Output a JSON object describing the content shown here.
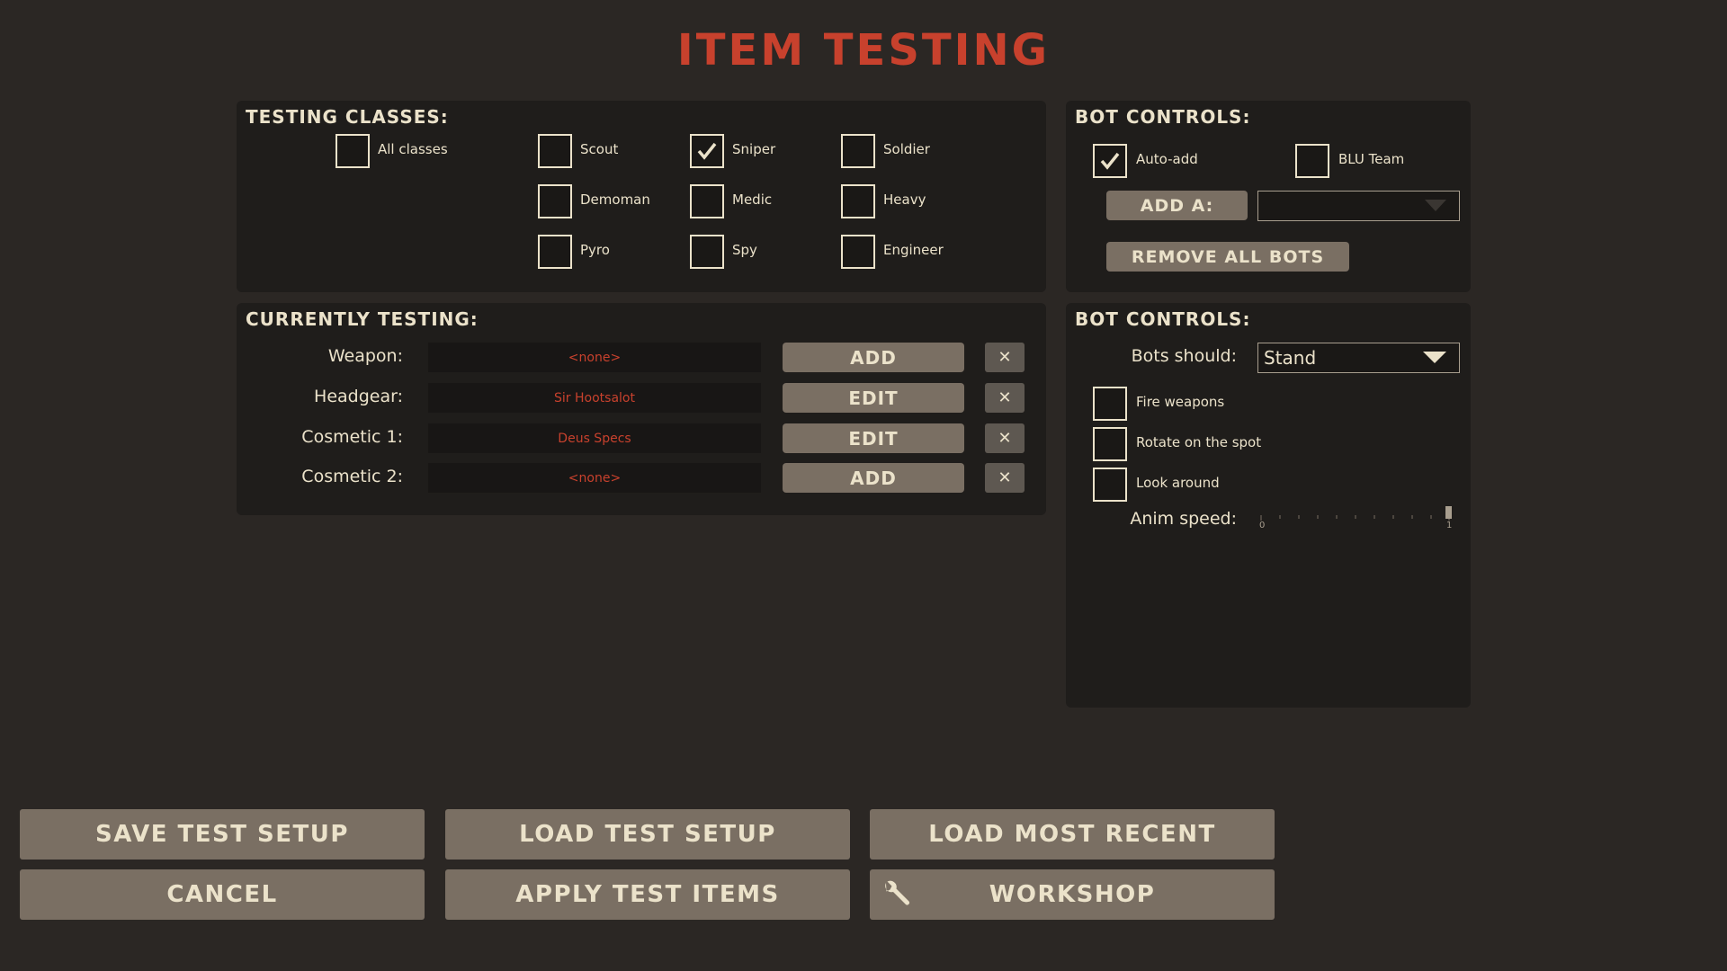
{
  "title": "ITEM TESTING",
  "classes_panel": {
    "heading": "TESTING CLASSES:",
    "items": [
      {
        "label": "All classes",
        "checked": false
      },
      {
        "label": "Scout",
        "checked": false
      },
      {
        "label": "Sniper",
        "checked": true
      },
      {
        "label": "Soldier",
        "checked": false
      },
      {
        "label": "Demoman",
        "checked": false
      },
      {
        "label": "Medic",
        "checked": false
      },
      {
        "label": "Heavy",
        "checked": false
      },
      {
        "label": "Pyro",
        "checked": false
      },
      {
        "label": "Spy",
        "checked": false
      },
      {
        "label": "Engineer",
        "checked": false
      }
    ]
  },
  "bot_controls_top": {
    "heading": "BOT CONTROLS:",
    "auto_add": {
      "label": "Auto-add",
      "checked": true
    },
    "blu_team": {
      "label": "BLU Team",
      "checked": false
    },
    "add_a_label": "ADD A:",
    "add_a_value": "",
    "remove_all_label": "REMOVE ALL BOTS"
  },
  "currently_testing": {
    "heading": "CURRENTLY TESTING:",
    "rows": [
      {
        "label": "Weapon:",
        "value": "<none>",
        "action": "ADD"
      },
      {
        "label": "Headgear:",
        "value": "Sir Hootsalot",
        "action": "EDIT"
      },
      {
        "label": "Cosmetic 1:",
        "value": "Deus Specs",
        "action": "EDIT"
      },
      {
        "label": "Cosmetic 2:",
        "value": "<none>",
        "action": "ADD"
      }
    ],
    "remove_symbol": "✕"
  },
  "bot_controls_bottom": {
    "heading": "BOT CONTROLS:",
    "bots_should_label": "Bots should:",
    "bots_should_value": "Stand",
    "options": [
      {
        "label": "Fire weapons",
        "checked": false
      },
      {
        "label": "Rotate on the spot",
        "checked": false
      },
      {
        "label": "Look around",
        "checked": false
      }
    ],
    "anim_speed_label": "Anim speed:",
    "anim_speed_min": "0",
    "anim_speed_max": "1",
    "anim_speed_value": 1
  },
  "footer": {
    "save": "SAVE TEST SETUP",
    "load": "LOAD TEST SETUP",
    "load_recent": "LOAD MOST RECENT",
    "cancel": "CANCEL",
    "apply": "APPLY TEST ITEMS",
    "workshop": "WORKSHOP"
  },
  "colors": {
    "accent": "#c8412d",
    "button": "#7a6f63",
    "panel": "#1f1d1b",
    "text": "#ebe2ca"
  }
}
